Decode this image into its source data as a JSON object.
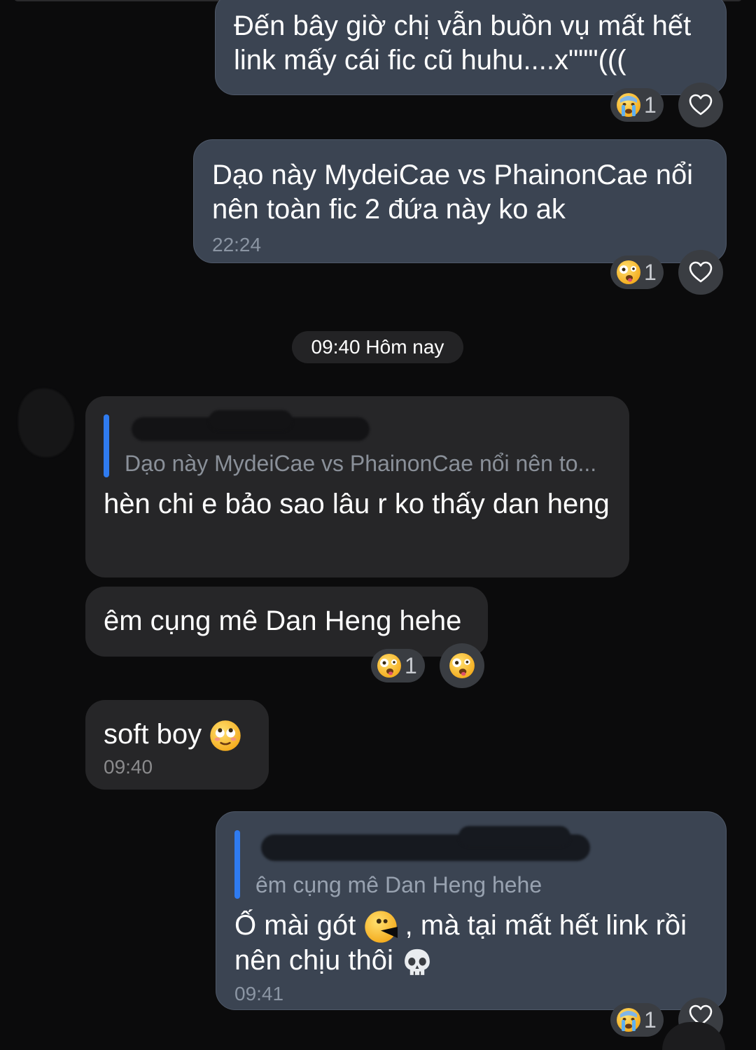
{
  "conversation": {
    "date_divider": "09:40 Hôm nay",
    "messages": [
      {
        "text": "Đến bây giờ chị vẫn buồn vụ mất hết link mấy cái fic cũ huhu....x\"\"\"(((",
        "reaction": {
          "emoji_icon": "crying-face-icon",
          "count": "1"
        }
      },
      {
        "text": "Dạo này MydeiCae vs PhainonCae nổi nên toàn fic 2 đứa này ko ak",
        "time": "22:24",
        "reaction": {
          "emoji_icon": "zany-face-icon",
          "count": "1"
        }
      },
      {
        "quoted": "Dạo này MydeiCae vs PhainonCae nổi nên to...",
        "text": "hèn chi e bảo sao lâu r ko thấy dan heng"
      },
      {
        "text": "êm cụng mê Dan Heng hehe",
        "reaction": {
          "emoji_icon": "zany-face-icon",
          "count": "1"
        }
      },
      {
        "text": "soft boy",
        "emoji_icon": "rolling-eyes-face-icon",
        "time": "09:40"
      },
      {
        "quoted": "êm cụng mê Dan Heng hehe",
        "text_part1": "Ố mài gót",
        "text_part2": ", mà tại mất hết link rồi",
        "text_part3": "nên chịu thôi",
        "time": "09:41",
        "reaction": {
          "emoji_icon": "crying-face-icon",
          "count": "1"
        }
      }
    ]
  },
  "colors": {
    "background": "#0b0b0c",
    "outgoing_bubble": "#3b4452",
    "incoming_bubble": "#262628",
    "quote_accent": "#2f7bf0"
  }
}
